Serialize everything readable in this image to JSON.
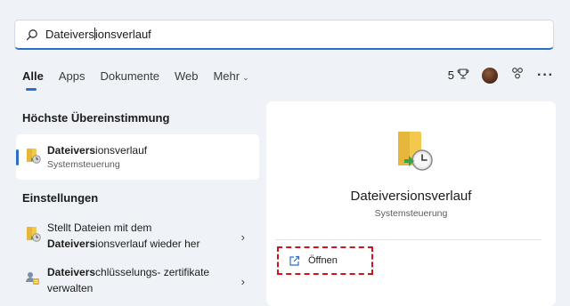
{
  "search": {
    "value_typed": "Dateivers",
    "value_rest": "ionsverlauf",
    "icon": "search-icon"
  },
  "tabs": [
    {
      "label": "Alle",
      "active": true
    },
    {
      "label": "Apps"
    },
    {
      "label": "Dokumente"
    },
    {
      "label": "Web"
    },
    {
      "label": "Mehr"
    }
  ],
  "toolbar": {
    "points": "5",
    "trophy_icon": "trophy-icon",
    "more_label": "···"
  },
  "best_match": {
    "heading": "Höchste Übereinstimmung",
    "title_bold": "Dateivers",
    "title_rest": "ionsverlauf",
    "subtitle": "Systemsteuerung"
  },
  "settings": {
    "heading": "Einstellungen",
    "items": [
      {
        "line1": "Stellt Dateien mit dem",
        "line2_bold": "Dateivers",
        "line2_rest": "ionsverlauf wieder her"
      },
      {
        "line1_bold": "Dateivers",
        "line1_rest": "chlüsselungs- zertifikate",
        "line2": "verwalten"
      }
    ]
  },
  "detail": {
    "title": "Dateiversionsverlauf",
    "subtitle": "Systemsteuerung",
    "open_label": "Öffnen"
  },
  "colors": {
    "accent": "#2a6fc9",
    "highlight_box": "#d1141a",
    "background": "#eff3f8"
  }
}
